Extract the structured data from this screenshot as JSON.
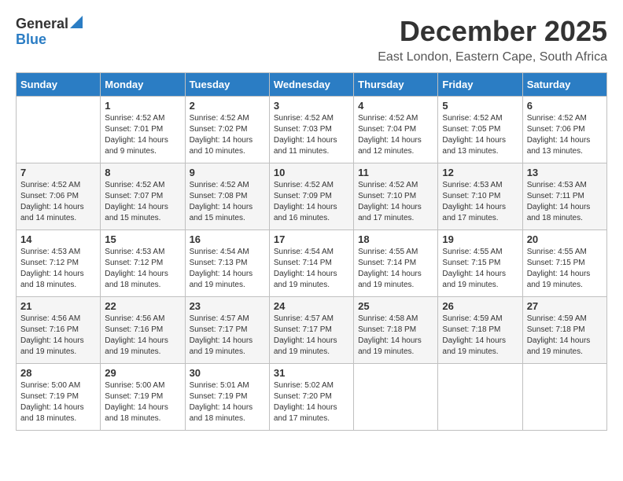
{
  "logo": {
    "general": "General",
    "blue": "Blue"
  },
  "title": {
    "month_year": "December 2025",
    "location": "East London, Eastern Cape, South Africa"
  },
  "days_of_week": [
    "Sunday",
    "Monday",
    "Tuesday",
    "Wednesday",
    "Thursday",
    "Friday",
    "Saturday"
  ],
  "weeks": [
    [
      {
        "day": null,
        "info": null
      },
      {
        "day": "1",
        "sunrise": "Sunrise: 4:52 AM",
        "sunset": "Sunset: 7:01 PM",
        "daylight": "Daylight: 14 hours and 9 minutes."
      },
      {
        "day": "2",
        "sunrise": "Sunrise: 4:52 AM",
        "sunset": "Sunset: 7:02 PM",
        "daylight": "Daylight: 14 hours and 10 minutes."
      },
      {
        "day": "3",
        "sunrise": "Sunrise: 4:52 AM",
        "sunset": "Sunset: 7:03 PM",
        "daylight": "Daylight: 14 hours and 11 minutes."
      },
      {
        "day": "4",
        "sunrise": "Sunrise: 4:52 AM",
        "sunset": "Sunset: 7:04 PM",
        "daylight": "Daylight: 14 hours and 12 minutes."
      },
      {
        "day": "5",
        "sunrise": "Sunrise: 4:52 AM",
        "sunset": "Sunset: 7:05 PM",
        "daylight": "Daylight: 14 hours and 13 minutes."
      },
      {
        "day": "6",
        "sunrise": "Sunrise: 4:52 AM",
        "sunset": "Sunset: 7:06 PM",
        "daylight": "Daylight: 14 hours and 13 minutes."
      }
    ],
    [
      {
        "day": "7",
        "sunrise": "Sunrise: 4:52 AM",
        "sunset": "Sunset: 7:06 PM",
        "daylight": "Daylight: 14 hours and 14 minutes."
      },
      {
        "day": "8",
        "sunrise": "Sunrise: 4:52 AM",
        "sunset": "Sunset: 7:07 PM",
        "daylight": "Daylight: 14 hours and 15 minutes."
      },
      {
        "day": "9",
        "sunrise": "Sunrise: 4:52 AM",
        "sunset": "Sunset: 7:08 PM",
        "daylight": "Daylight: 14 hours and 15 minutes."
      },
      {
        "day": "10",
        "sunrise": "Sunrise: 4:52 AM",
        "sunset": "Sunset: 7:09 PM",
        "daylight": "Daylight: 14 hours and 16 minutes."
      },
      {
        "day": "11",
        "sunrise": "Sunrise: 4:52 AM",
        "sunset": "Sunset: 7:10 PM",
        "daylight": "Daylight: 14 hours and 17 minutes."
      },
      {
        "day": "12",
        "sunrise": "Sunrise: 4:53 AM",
        "sunset": "Sunset: 7:10 PM",
        "daylight": "Daylight: 14 hours and 17 minutes."
      },
      {
        "day": "13",
        "sunrise": "Sunrise: 4:53 AM",
        "sunset": "Sunset: 7:11 PM",
        "daylight": "Daylight: 14 hours and 18 minutes."
      }
    ],
    [
      {
        "day": "14",
        "sunrise": "Sunrise: 4:53 AM",
        "sunset": "Sunset: 7:12 PM",
        "daylight": "Daylight: 14 hours and 18 minutes."
      },
      {
        "day": "15",
        "sunrise": "Sunrise: 4:53 AM",
        "sunset": "Sunset: 7:12 PM",
        "daylight": "Daylight: 14 hours and 18 minutes."
      },
      {
        "day": "16",
        "sunrise": "Sunrise: 4:54 AM",
        "sunset": "Sunset: 7:13 PM",
        "daylight": "Daylight: 14 hours and 19 minutes."
      },
      {
        "day": "17",
        "sunrise": "Sunrise: 4:54 AM",
        "sunset": "Sunset: 7:14 PM",
        "daylight": "Daylight: 14 hours and 19 minutes."
      },
      {
        "day": "18",
        "sunrise": "Sunrise: 4:55 AM",
        "sunset": "Sunset: 7:14 PM",
        "daylight": "Daylight: 14 hours and 19 minutes."
      },
      {
        "day": "19",
        "sunrise": "Sunrise: 4:55 AM",
        "sunset": "Sunset: 7:15 PM",
        "daylight": "Daylight: 14 hours and 19 minutes."
      },
      {
        "day": "20",
        "sunrise": "Sunrise: 4:55 AM",
        "sunset": "Sunset: 7:15 PM",
        "daylight": "Daylight: 14 hours and 19 minutes."
      }
    ],
    [
      {
        "day": "21",
        "sunrise": "Sunrise: 4:56 AM",
        "sunset": "Sunset: 7:16 PM",
        "daylight": "Daylight: 14 hours and 19 minutes."
      },
      {
        "day": "22",
        "sunrise": "Sunrise: 4:56 AM",
        "sunset": "Sunset: 7:16 PM",
        "daylight": "Daylight: 14 hours and 19 minutes."
      },
      {
        "day": "23",
        "sunrise": "Sunrise: 4:57 AM",
        "sunset": "Sunset: 7:17 PM",
        "daylight": "Daylight: 14 hours and 19 minutes."
      },
      {
        "day": "24",
        "sunrise": "Sunrise: 4:57 AM",
        "sunset": "Sunset: 7:17 PM",
        "daylight": "Daylight: 14 hours and 19 minutes."
      },
      {
        "day": "25",
        "sunrise": "Sunrise: 4:58 AM",
        "sunset": "Sunset: 7:18 PM",
        "daylight": "Daylight: 14 hours and 19 minutes."
      },
      {
        "day": "26",
        "sunrise": "Sunrise: 4:59 AM",
        "sunset": "Sunset: 7:18 PM",
        "daylight": "Daylight: 14 hours and 19 minutes."
      },
      {
        "day": "27",
        "sunrise": "Sunrise: 4:59 AM",
        "sunset": "Sunset: 7:18 PM",
        "daylight": "Daylight: 14 hours and 19 minutes."
      }
    ],
    [
      {
        "day": "28",
        "sunrise": "Sunrise: 5:00 AM",
        "sunset": "Sunset: 7:19 PM",
        "daylight": "Daylight: 14 hours and 18 minutes."
      },
      {
        "day": "29",
        "sunrise": "Sunrise: 5:00 AM",
        "sunset": "Sunset: 7:19 PM",
        "daylight": "Daylight: 14 hours and 18 minutes."
      },
      {
        "day": "30",
        "sunrise": "Sunrise: 5:01 AM",
        "sunset": "Sunset: 7:19 PM",
        "daylight": "Daylight: 14 hours and 18 minutes."
      },
      {
        "day": "31",
        "sunrise": "Sunrise: 5:02 AM",
        "sunset": "Sunset: 7:20 PM",
        "daylight": "Daylight: 14 hours and 17 minutes."
      },
      {
        "day": null,
        "info": null
      },
      {
        "day": null,
        "info": null
      },
      {
        "day": null,
        "info": null
      }
    ]
  ]
}
